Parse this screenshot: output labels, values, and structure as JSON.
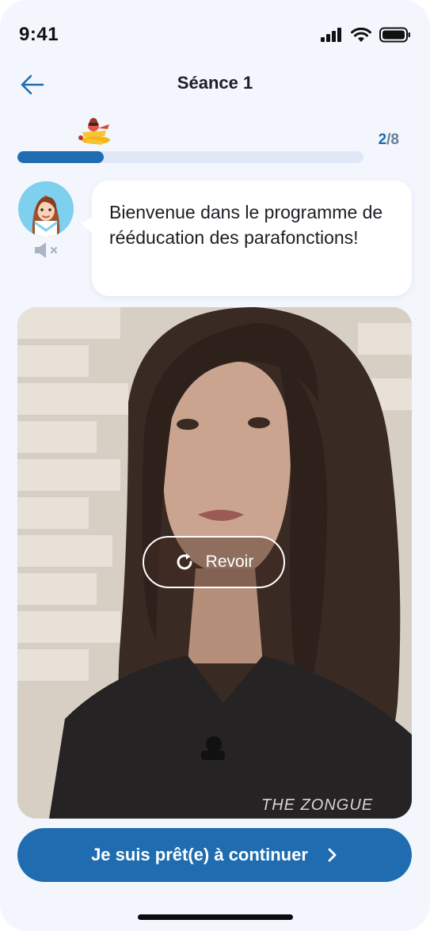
{
  "status_bar": {
    "time": "9:41",
    "icons": [
      "signal-icon",
      "wifi-icon",
      "battery-icon"
    ]
  },
  "header": {
    "title": "Séance 1",
    "back_icon": "arrow-left-icon"
  },
  "progress": {
    "current": "2",
    "separator_total": "/8",
    "fraction": 0.25,
    "mascot_icon": "airplane-pilot-icon"
  },
  "assistant": {
    "avatar_icon": "doctor-avatar-icon",
    "mute_icon": "speaker-muted-icon",
    "message": "Bienvenue dans le programme de rééducation des parafonctions!"
  },
  "video": {
    "replay_label": "Revoir",
    "replay_icon": "replay-icon",
    "shirt_text": "THE ZONGUE"
  },
  "cta": {
    "label": "Je suis prêt(e) à continuer",
    "icon": "chevron-right-icon"
  },
  "colors": {
    "primary": "#1f6db0",
    "background": "#f3f6fd",
    "track": "#e0e8f7"
  }
}
